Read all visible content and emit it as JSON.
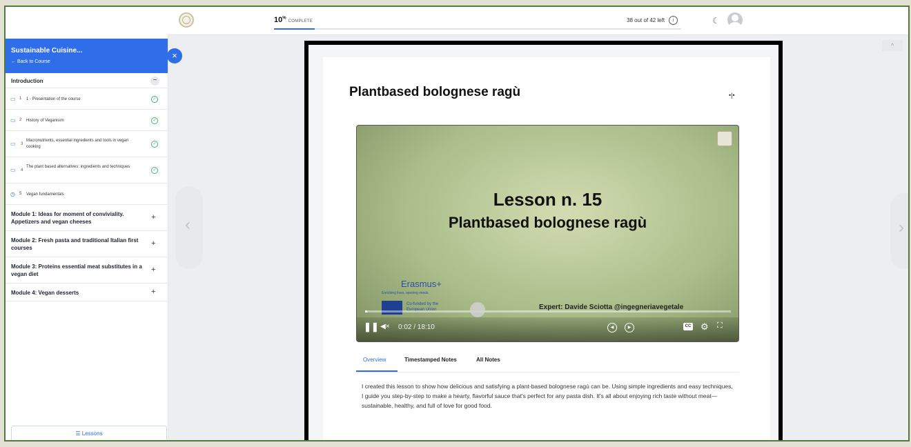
{
  "topbar": {
    "progress_value": "10",
    "progress_unit": "%",
    "progress_label": "COMPLETE",
    "progress_fraction": 0.1,
    "remaining_text": "38 out of 42 left",
    "info_icon": "i",
    "moon_icon": "☾"
  },
  "sidebar": {
    "course_title": "Sustainable Cuisine...",
    "back_label": "← Back to Course",
    "close_icon": "×",
    "intro_section": {
      "label": "Introduction",
      "toggle": "−",
      "lessons": [
        {
          "num": "1",
          "label": "1 - Presentation of the course",
          "status": "✓"
        },
        {
          "num": "2",
          "label": "History of Veganisim",
          "status": "✓"
        },
        {
          "num": "3",
          "label": "Macronutrients, essential ingredients and tools in vegan cooking",
          "status": "✓"
        },
        {
          "num": "4",
          "label": "The plant based alternatives: ingredients and techniques",
          "status": "✓"
        },
        {
          "num": "5",
          "label": "Vegan fundamentals",
          "status": ""
        }
      ]
    },
    "modules": [
      {
        "label": "Module 1: Ideas for moment of conviviality. Appetizers and vegan cheeses",
        "toggle": "+"
      },
      {
        "label": "Module 2: Fresh pasta and traditional Italian first courses",
        "toggle": "+"
      },
      {
        "label": "Module 3: Proteins essential meat substitutes in a vegan diet",
        "toggle": "+"
      },
      {
        "label": "Module 4: Vegan desserts",
        "toggle": "+"
      }
    ],
    "lessons_button": "☰ Lessons"
  },
  "nav": {
    "prev": "‹",
    "next": "›",
    "scroll_up": "^"
  },
  "lesson": {
    "title": "Plantbased bolognese ragù",
    "expand_icon": "•|•"
  },
  "video": {
    "title_line1": "Lesson n. 15",
    "title_line2": "Plantbased bolognese ragù",
    "erasmus": "Erasmus+",
    "erasmus_sub": "Enriching lives, opening minds.",
    "cofunded": "Co-funded by the European Union",
    "expert": "Expert: Davide Sciotta @ingegneriavegetale",
    "time": "0:02 / 18:10",
    "played_fraction": 0.002,
    "pause_icon": "❚❚",
    "mute_icon": "◀×",
    "rewind_icon": "◀",
    "forward_icon": "▶",
    "cc_icon": "CC",
    "settings_icon": "⚙",
    "fullscreen_icon": "⛶"
  },
  "tabs": [
    "Overview",
    "Timestamped Notes",
    "All Notes"
  ],
  "description": "I created this lesson to show how delicious and satisfying a plant-based bolognese ragù can be. Using simple ingredients and easy techniques, I guide you step-by-step to make a hearty, flavorful sauce that's perfect for any pasta dish. It's all about enjoying rich taste without meat—sustainable, healthy, and full of love for good food."
}
